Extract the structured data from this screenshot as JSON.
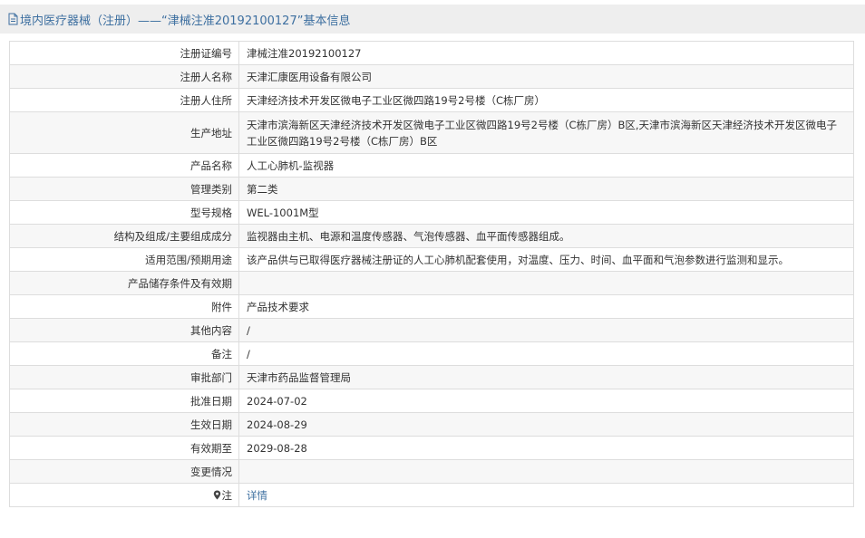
{
  "header": {
    "title": "境内医疗器械（注册）——“津械注准20192100127”基本信息",
    "icon": "document-icon"
  },
  "rows": [
    {
      "label": "注册证编号",
      "value": "津械注准20192100127"
    },
    {
      "label": "注册人名称",
      "value": "天津汇康医用设备有限公司"
    },
    {
      "label": "注册人住所",
      "value": "天津经济技术开发区微电子工业区微四路19号2号楼（C栋厂房）"
    },
    {
      "label": "生产地址",
      "value": "天津市滨海新区天津经济技术开发区微电子工业区微四路19号2号楼（C栋厂房）B区,天津市滨海新区天津经济技术开发区微电子工业区微四路19号2号楼（C栋厂房）B区"
    },
    {
      "label": "产品名称",
      "value": "人工心肺机-监视器"
    },
    {
      "label": "管理类别",
      "value": "第二类"
    },
    {
      "label": "型号规格",
      "value": "WEL-1001M型"
    },
    {
      "label": "结构及组成/主要组成成分",
      "value": "监视器由主机、电源和温度传感器、气泡传感器、血平面传感器组成。"
    },
    {
      "label": "适用范围/预期用途",
      "value": "该产品供与已取得医疗器械注册证的人工心肺机配套使用，对温度、压力、时间、血平面和气泡参数进行监测和显示。"
    },
    {
      "label": "产品储存条件及有效期",
      "value": ""
    },
    {
      "label": "附件",
      "value": "产品技术要求"
    },
    {
      "label": "其他内容",
      "value": "/"
    },
    {
      "label": "备注",
      "value": "/"
    },
    {
      "label": "审批部门",
      "value": "天津市药品监督管理局"
    },
    {
      "label": "批准日期",
      "value": "2024-07-02"
    },
    {
      "label": "生效日期",
      "value": "2024-08-29"
    },
    {
      "label": "有效期至",
      "value": "2029-08-28"
    },
    {
      "label": "变更情况",
      "value": ""
    }
  ],
  "note": {
    "icon": "location-pin-icon",
    "label": "注",
    "link": "详情"
  },
  "colors": {
    "accent": "#3d6fa0",
    "header_bg": "#eeeeee",
    "border": "#dddddd",
    "stripe": "#f7f7f7"
  }
}
